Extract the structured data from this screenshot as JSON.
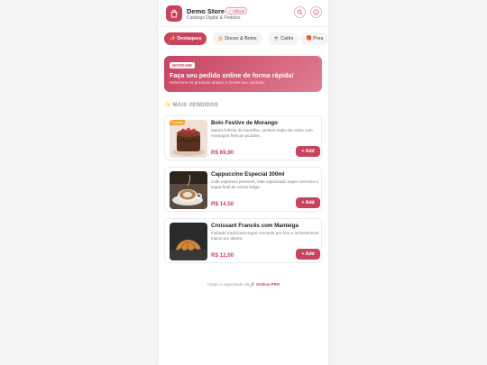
{
  "header": {
    "store_name": "Demo Store",
    "badge": "Oficial",
    "subtitle": "Catálogo Digital & Pedidos",
    "icons": [
      "shopping-bag-icon",
      "search-icon",
      "info-icon"
    ]
  },
  "tabs": [
    {
      "label": "✨ Destaques",
      "active": true
    },
    {
      "label": "🎂 Doces & Bolos",
      "active": false
    },
    {
      "label": "☕ Cafés",
      "active": false
    },
    {
      "label": "🎁 Pres",
      "active": false
    }
  ],
  "hero": {
    "tag": "NOVIDADE",
    "title": "Faça seu pedido online de forma rápida!",
    "subtitle": "Selecione os produtos abaixo e monte seu carrinho."
  },
  "section": {
    "icon": "✨",
    "title": "MAIS VENDIDOS"
  },
  "products": [
    {
      "name": "Bolo Festivo de Morango",
      "description": "Massa fofinha de baunilha, recheio duplo de ninho com morangos frescos picados.",
      "price": "R$ 89,90",
      "flag": "Popular",
      "add_label": "+ Add"
    },
    {
      "name": "Cappuccino Especial 300ml",
      "description": "Café espresso premium, leite vaporizado super cremoso e toque final de cacau belga.",
      "price": "R$ 14,50",
      "flag": "",
      "add_label": "+ Add"
    },
    {
      "name": "Croissant Francês com Manteiga",
      "description": "Folhado tradicional super crocante por fora e incrivelmente macio por dentro.",
      "price": "R$ 12,00",
      "flag": "",
      "add_label": "+ Add"
    }
  ],
  "footer": {
    "text": "Criado e organizado via",
    "brand": "🔗 Ordena PRO"
  },
  "colors": {
    "accent": "#c9435f",
    "accent_light": "#e07d92",
    "flag": "#f2a32a"
  }
}
